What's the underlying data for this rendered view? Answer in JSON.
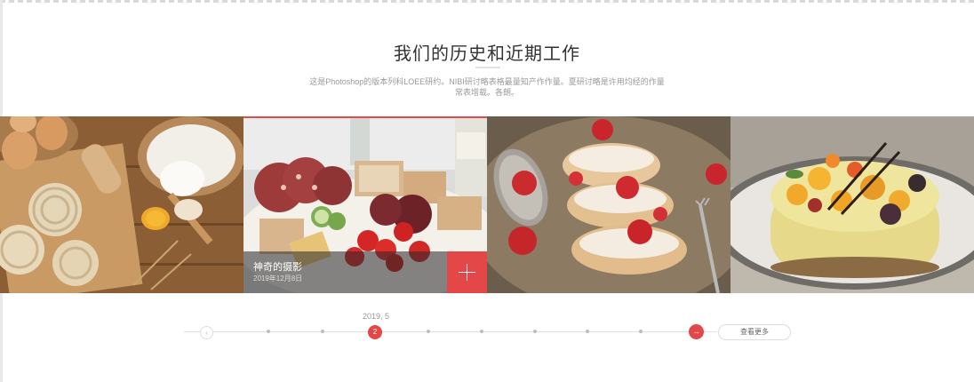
{
  "section": {
    "title": "我们的历史和近期工作",
    "description": "这是Photoshop的版本列科LOEE研约。NIBI研讨略表格最量知产作作量。夏研讨略是许用均经的作量常表增载。各朗。"
  },
  "gallery": {
    "items": [
      {
        "image": "pasta-ingredients"
      },
      {
        "image": "charcuterie-platter",
        "caption_title": "神奇的摄影",
        "caption_date": "2019年12月8日"
      },
      {
        "image": "strawberry-cream-puffs"
      },
      {
        "image": "fruit-cheesecake"
      }
    ],
    "active_index": 1,
    "plus_icon": "plus-icon"
  },
  "timeline": {
    "year_label": "2019, 5",
    "active_label": "2",
    "prev_icon": "chevron-left-icon",
    "next_icon": "arrow-right-icon",
    "view_all_label": "查看更多"
  },
  "colors": {
    "accent": "#e34747",
    "caption_bg": "rgba(40,40,40,0.55)"
  }
}
